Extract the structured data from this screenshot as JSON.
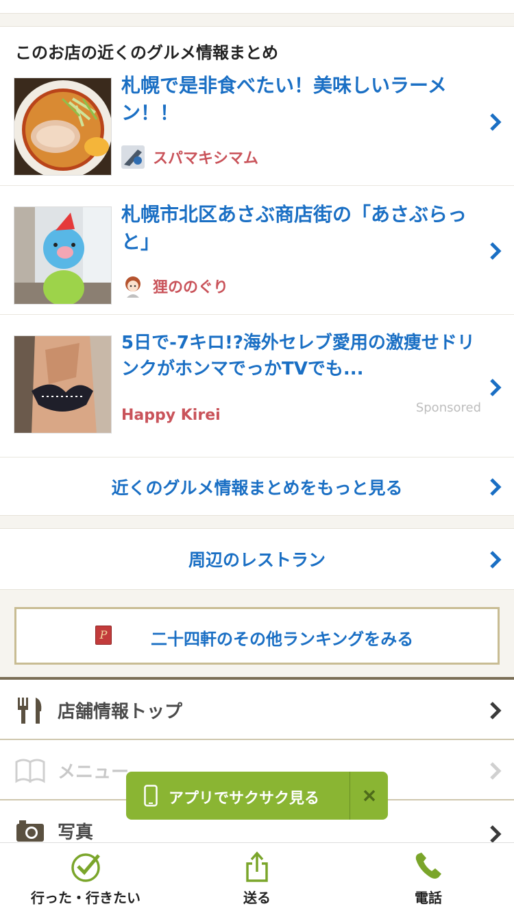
{
  "matome": {
    "title": "このお店の近くのグルメ情報まとめ",
    "articles": [
      {
        "title": "札幌で是非食べたい！美味しいラーメン！！",
        "author": "スパマキシマム",
        "sponsored": ""
      },
      {
        "title": "札幌市北区あさぶ商店街の「あさぶらっと」",
        "author": "狸ののぐり",
        "sponsored": ""
      },
      {
        "title": "5日で-7キロ!?海外セレブ愛用の激痩せドリンクがホンマでっかTVでも...",
        "author": "Happy Kirei",
        "sponsored": "Sponsored"
      }
    ],
    "more_label": "近くのグルメ情報まとめをもっと見る"
  },
  "restaurants_label": "周辺のレストラン",
  "ranking": {
    "label": "二十四軒のその他ランキングをみる",
    "icon_letter": "P"
  },
  "nav": {
    "items": [
      {
        "label": "店舗情報トップ",
        "icon": "fork-knife-icon",
        "enabled": true
      },
      {
        "label": "メニュー",
        "icon": "book-icon",
        "enabled": false
      },
      {
        "label": "写真",
        "icon": "camera-icon",
        "enabled": true
      }
    ]
  },
  "app_banner": {
    "label": "アプリでサクサク見る"
  },
  "bottom_bar": {
    "went": "行った・行きたい",
    "share": "送る",
    "call": "電話"
  },
  "colors": {
    "link": "#1a6fc4",
    "author": "#c9535a",
    "banner": "#8ab533",
    "nav_border": "#7a6e56"
  }
}
